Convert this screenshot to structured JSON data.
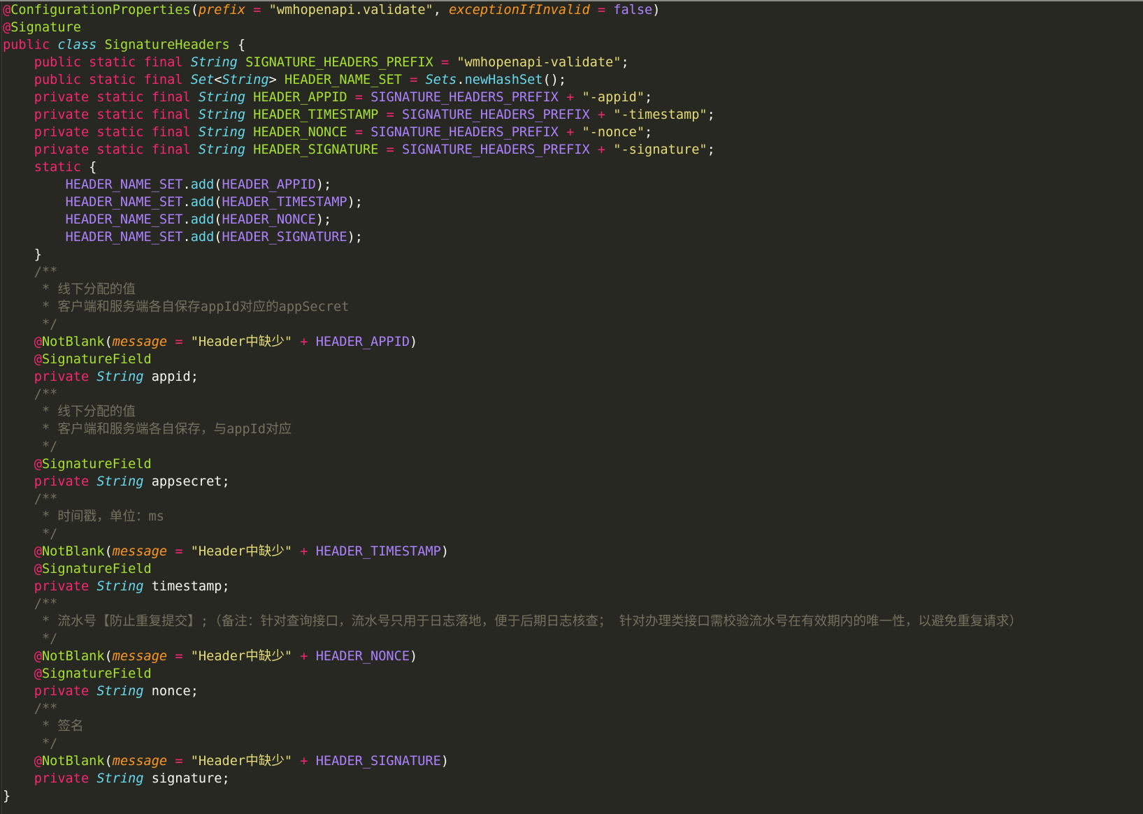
{
  "editor": {
    "theme": "monokai",
    "colors": {
      "background": "#272822",
      "keyword": "#f92672",
      "type": "#66d9ef",
      "class_name": "#a6e22e",
      "constant": "#ae81ff",
      "string": "#e6db74",
      "comment": "#75715e",
      "parameter": "#fd971f",
      "function": "#66d9ef",
      "plain": "#f8f8f2"
    },
    "lines": [
      [
        [
          "kw",
          "@"
        ],
        [
          "ann",
          "ConfigurationProperties"
        ],
        [
          "plain",
          "("
        ],
        [
          "par",
          "prefix"
        ],
        [
          "plain",
          " "
        ],
        [
          "kw",
          "="
        ],
        [
          "plain",
          " "
        ],
        [
          "str",
          "\"wmhopenapi.validate\""
        ],
        [
          "plain",
          ", "
        ],
        [
          "par",
          "exceptionIfInvalid"
        ],
        [
          "plain",
          " "
        ],
        [
          "kw",
          "="
        ],
        [
          "plain",
          " "
        ],
        [
          "const",
          "false"
        ],
        [
          "plain",
          ")"
        ]
      ],
      [
        [
          "kw",
          "@"
        ],
        [
          "ann",
          "Signature"
        ]
      ],
      [
        [
          "kw",
          "public"
        ],
        [
          "plain",
          " "
        ],
        [
          "type",
          "class"
        ],
        [
          "plain",
          " "
        ],
        [
          "cls",
          "SignatureHeaders"
        ],
        [
          "plain",
          " {"
        ]
      ],
      [
        [
          "plain",
          "    "
        ],
        [
          "kw",
          "public static final"
        ],
        [
          "plain",
          " "
        ],
        [
          "type",
          "String"
        ],
        [
          "plain",
          " "
        ],
        [
          "cls",
          "SIGNATURE_HEADERS_PREFIX"
        ],
        [
          "plain",
          " "
        ],
        [
          "kw",
          "="
        ],
        [
          "plain",
          " "
        ],
        [
          "str",
          "\"wmhopenapi-validate\""
        ],
        [
          "plain",
          ";"
        ]
      ],
      [
        [
          "plain",
          "    "
        ],
        [
          "kw",
          "public static final"
        ],
        [
          "plain",
          " "
        ],
        [
          "type",
          "Set"
        ],
        [
          "plain",
          "<"
        ],
        [
          "type",
          "String"
        ],
        [
          "plain",
          "> "
        ],
        [
          "cls",
          "HEADER_NAME_SET"
        ],
        [
          "plain",
          " "
        ],
        [
          "kw",
          "="
        ],
        [
          "plain",
          " "
        ],
        [
          "type",
          "Sets"
        ],
        [
          "plain",
          "."
        ],
        [
          "fn",
          "newHashSet"
        ],
        [
          "plain",
          "();"
        ]
      ],
      [
        [
          "plain",
          "    "
        ],
        [
          "kw",
          "private static final"
        ],
        [
          "plain",
          " "
        ],
        [
          "type",
          "String"
        ],
        [
          "plain",
          " "
        ],
        [
          "cls",
          "HEADER_APPID"
        ],
        [
          "plain",
          " "
        ],
        [
          "kw",
          "="
        ],
        [
          "plain",
          " "
        ],
        [
          "const",
          "SIGNATURE_HEADERS_PREFIX"
        ],
        [
          "plain",
          " "
        ],
        [
          "kw",
          "+"
        ],
        [
          "plain",
          " "
        ],
        [
          "str",
          "\"-appid\""
        ],
        [
          "plain",
          ";"
        ]
      ],
      [
        [
          "plain",
          "    "
        ],
        [
          "kw",
          "private static final"
        ],
        [
          "plain",
          " "
        ],
        [
          "type",
          "String"
        ],
        [
          "plain",
          " "
        ],
        [
          "cls",
          "HEADER_TIMESTAMP"
        ],
        [
          "plain",
          " "
        ],
        [
          "kw",
          "="
        ],
        [
          "plain",
          " "
        ],
        [
          "const",
          "SIGNATURE_HEADERS_PREFIX"
        ],
        [
          "plain",
          " "
        ],
        [
          "kw",
          "+"
        ],
        [
          "plain",
          " "
        ],
        [
          "str",
          "\"-timestamp\""
        ],
        [
          "plain",
          ";"
        ]
      ],
      [
        [
          "plain",
          "    "
        ],
        [
          "kw",
          "private static final"
        ],
        [
          "plain",
          " "
        ],
        [
          "type",
          "String"
        ],
        [
          "plain",
          " "
        ],
        [
          "cls",
          "HEADER_NONCE"
        ],
        [
          "plain",
          " "
        ],
        [
          "kw",
          "="
        ],
        [
          "plain",
          " "
        ],
        [
          "const",
          "SIGNATURE_HEADERS_PREFIX"
        ],
        [
          "plain",
          " "
        ],
        [
          "kw",
          "+"
        ],
        [
          "plain",
          " "
        ],
        [
          "str",
          "\"-nonce\""
        ],
        [
          "plain",
          ";"
        ]
      ],
      [
        [
          "plain",
          "    "
        ],
        [
          "kw",
          "private static final"
        ],
        [
          "plain",
          " "
        ],
        [
          "type",
          "String"
        ],
        [
          "plain",
          " "
        ],
        [
          "cls",
          "HEADER_SIGNATURE"
        ],
        [
          "plain",
          " "
        ],
        [
          "kw",
          "="
        ],
        [
          "plain",
          " "
        ],
        [
          "const",
          "SIGNATURE_HEADERS_PREFIX"
        ],
        [
          "plain",
          " "
        ],
        [
          "kw",
          "+"
        ],
        [
          "plain",
          " "
        ],
        [
          "str",
          "\"-signature\""
        ],
        [
          "plain",
          ";"
        ]
      ],
      [
        [
          "plain",
          "    "
        ],
        [
          "kw",
          "static"
        ],
        [
          "plain",
          " {"
        ]
      ],
      [
        [
          "plain",
          "        "
        ],
        [
          "const",
          "HEADER_NAME_SET"
        ],
        [
          "plain",
          "."
        ],
        [
          "fn",
          "add"
        ],
        [
          "plain",
          "("
        ],
        [
          "const",
          "HEADER_APPID"
        ],
        [
          "plain",
          ");"
        ]
      ],
      [
        [
          "plain",
          "        "
        ],
        [
          "const",
          "HEADER_NAME_SET"
        ],
        [
          "plain",
          "."
        ],
        [
          "fn",
          "add"
        ],
        [
          "plain",
          "("
        ],
        [
          "const",
          "HEADER_TIMESTAMP"
        ],
        [
          "plain",
          ");"
        ]
      ],
      [
        [
          "plain",
          "        "
        ],
        [
          "const",
          "HEADER_NAME_SET"
        ],
        [
          "plain",
          "."
        ],
        [
          "fn",
          "add"
        ],
        [
          "plain",
          "("
        ],
        [
          "const",
          "HEADER_NONCE"
        ],
        [
          "plain",
          ");"
        ]
      ],
      [
        [
          "plain",
          "        "
        ],
        [
          "const",
          "HEADER_NAME_SET"
        ],
        [
          "plain",
          "."
        ],
        [
          "fn",
          "add"
        ],
        [
          "plain",
          "("
        ],
        [
          "const",
          "HEADER_SIGNATURE"
        ],
        [
          "plain",
          ");"
        ]
      ],
      [
        [
          "plain",
          "    }"
        ]
      ],
      [
        [
          "plain",
          "    "
        ],
        [
          "cmt",
          "/**"
        ]
      ],
      [
        [
          "plain",
          "     "
        ],
        [
          "cmt",
          "* 线下分配的值"
        ]
      ],
      [
        [
          "plain",
          "     "
        ],
        [
          "cmt",
          "* 客户端和服务端各自保存appId对应的appSecret"
        ]
      ],
      [
        [
          "plain",
          "     "
        ],
        [
          "cmt",
          "*/"
        ]
      ],
      [
        [
          "plain",
          "    "
        ],
        [
          "kw",
          "@"
        ],
        [
          "ann",
          "NotBlank"
        ],
        [
          "plain",
          "("
        ],
        [
          "par",
          "message"
        ],
        [
          "plain",
          " "
        ],
        [
          "kw",
          "="
        ],
        [
          "plain",
          " "
        ],
        [
          "str",
          "\"Header中缺少\""
        ],
        [
          "plain",
          " "
        ],
        [
          "kw",
          "+"
        ],
        [
          "plain",
          " "
        ],
        [
          "const",
          "HEADER_APPID"
        ],
        [
          "plain",
          ")"
        ]
      ],
      [
        [
          "plain",
          "    "
        ],
        [
          "kw",
          "@"
        ],
        [
          "ann",
          "SignatureField"
        ]
      ],
      [
        [
          "plain",
          "    "
        ],
        [
          "kw",
          "private"
        ],
        [
          "plain",
          " "
        ],
        [
          "type",
          "String"
        ],
        [
          "plain",
          " appid;"
        ]
      ],
      [
        [
          "plain",
          "    "
        ],
        [
          "cmt",
          "/**"
        ]
      ],
      [
        [
          "plain",
          "     "
        ],
        [
          "cmt",
          "* 线下分配的值"
        ]
      ],
      [
        [
          "plain",
          "     "
        ],
        [
          "cmt",
          "* 客户端和服务端各自保存，与appId对应"
        ]
      ],
      [
        [
          "plain",
          "     "
        ],
        [
          "cmt",
          "*/"
        ]
      ],
      [
        [
          "plain",
          "    "
        ],
        [
          "kw",
          "@"
        ],
        [
          "ann",
          "SignatureField"
        ]
      ],
      [
        [
          "plain",
          "    "
        ],
        [
          "kw",
          "private"
        ],
        [
          "plain",
          " "
        ],
        [
          "type",
          "String"
        ],
        [
          "plain",
          " appsecret;"
        ]
      ],
      [
        [
          "plain",
          "    "
        ],
        [
          "cmt",
          "/**"
        ]
      ],
      [
        [
          "plain",
          "     "
        ],
        [
          "cmt",
          "* 时间戳，单位：ms"
        ]
      ],
      [
        [
          "plain",
          "     "
        ],
        [
          "cmt",
          "*/"
        ]
      ],
      [
        [
          "plain",
          "    "
        ],
        [
          "kw",
          "@"
        ],
        [
          "ann",
          "NotBlank"
        ],
        [
          "plain",
          "("
        ],
        [
          "par",
          "message"
        ],
        [
          "plain",
          " "
        ],
        [
          "kw",
          "="
        ],
        [
          "plain",
          " "
        ],
        [
          "str",
          "\"Header中缺少\""
        ],
        [
          "plain",
          " "
        ],
        [
          "kw",
          "+"
        ],
        [
          "plain",
          " "
        ],
        [
          "const",
          "HEADER_TIMESTAMP"
        ],
        [
          "plain",
          ")"
        ]
      ],
      [
        [
          "plain",
          "    "
        ],
        [
          "kw",
          "@"
        ],
        [
          "ann",
          "SignatureField"
        ]
      ],
      [
        [
          "plain",
          "    "
        ],
        [
          "kw",
          "private"
        ],
        [
          "plain",
          " "
        ],
        [
          "type",
          "String"
        ],
        [
          "plain",
          " timestamp;"
        ]
      ],
      [
        [
          "plain",
          "    "
        ],
        [
          "cmt",
          "/**"
        ]
      ],
      [
        [
          "plain",
          "     "
        ],
        [
          "cmt",
          "* 流水号【防止重复提交】;（备注：针对查询接口，流水号只用于日志落地，便于后期日志核查； 针对办理类接口需校验流水号在有效期内的唯一性，以避免重复请求）"
        ]
      ],
      [
        [
          "plain",
          "     "
        ],
        [
          "cmt",
          "*/"
        ]
      ],
      [
        [
          "plain",
          "    "
        ],
        [
          "kw",
          "@"
        ],
        [
          "ann",
          "NotBlank"
        ],
        [
          "plain",
          "("
        ],
        [
          "par",
          "message"
        ],
        [
          "plain",
          " "
        ],
        [
          "kw",
          "="
        ],
        [
          "plain",
          " "
        ],
        [
          "str",
          "\"Header中缺少\""
        ],
        [
          "plain",
          " "
        ],
        [
          "kw",
          "+"
        ],
        [
          "plain",
          " "
        ],
        [
          "const",
          "HEADER_NONCE"
        ],
        [
          "plain",
          ")"
        ]
      ],
      [
        [
          "plain",
          "    "
        ],
        [
          "kw",
          "@"
        ],
        [
          "ann",
          "SignatureField"
        ]
      ],
      [
        [
          "plain",
          "    "
        ],
        [
          "kw",
          "private"
        ],
        [
          "plain",
          " "
        ],
        [
          "type",
          "String"
        ],
        [
          "plain",
          " nonce;"
        ]
      ],
      [
        [
          "plain",
          "    "
        ],
        [
          "cmt",
          "/**"
        ]
      ],
      [
        [
          "plain",
          "     "
        ],
        [
          "cmt",
          "* 签名"
        ]
      ],
      [
        [
          "plain",
          "     "
        ],
        [
          "cmt",
          "*/"
        ]
      ],
      [
        [
          "plain",
          "    "
        ],
        [
          "kw",
          "@"
        ],
        [
          "ann",
          "NotBlank"
        ],
        [
          "plain",
          "("
        ],
        [
          "par",
          "message"
        ],
        [
          "plain",
          " "
        ],
        [
          "kw",
          "="
        ],
        [
          "plain",
          " "
        ],
        [
          "str",
          "\"Header中缺少\""
        ],
        [
          "plain",
          " "
        ],
        [
          "kw",
          "+"
        ],
        [
          "plain",
          " "
        ],
        [
          "const",
          "HEADER_SIGNATURE"
        ],
        [
          "plain",
          ")"
        ]
      ],
      [
        [
          "plain",
          "    "
        ],
        [
          "kw",
          "private"
        ],
        [
          "plain",
          " "
        ],
        [
          "type",
          "String"
        ],
        [
          "plain",
          " signature;"
        ]
      ],
      [
        [
          "plain",
          "}"
        ]
      ]
    ]
  }
}
